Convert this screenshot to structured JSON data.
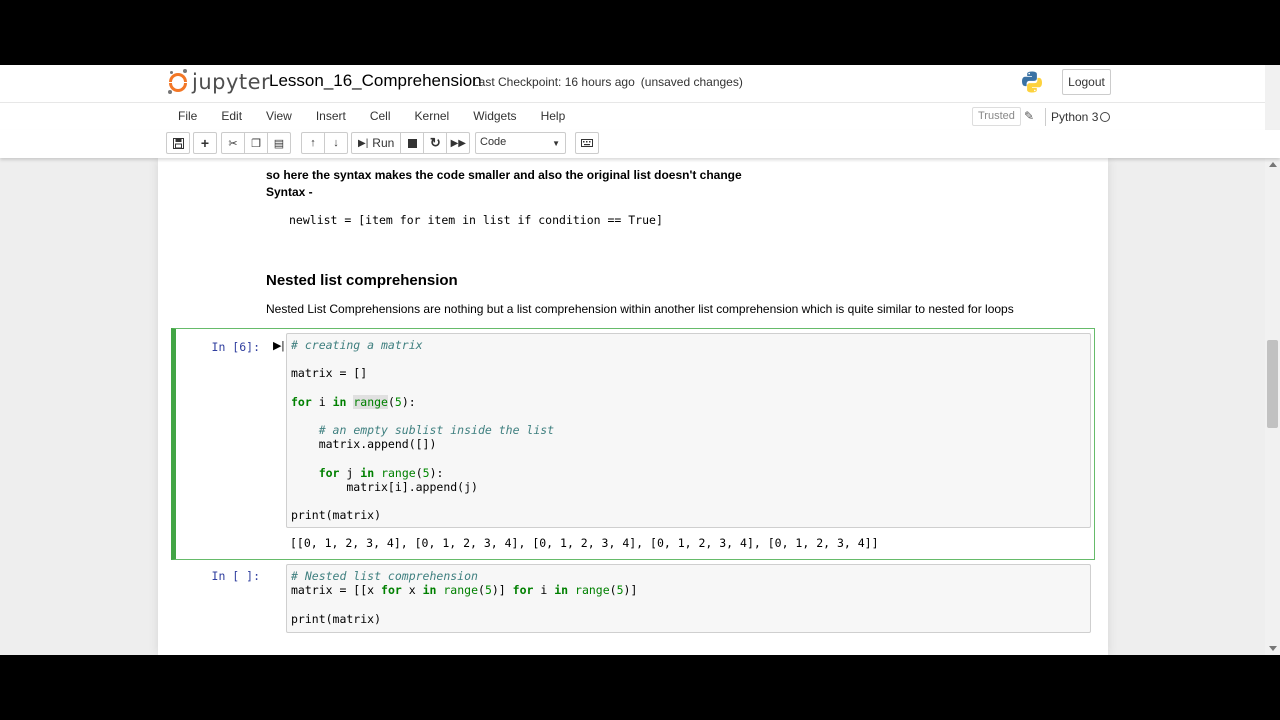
{
  "header": {
    "logo_text": "jupyter",
    "notebook_title": "Lesson_16_Comprehension",
    "checkpoint": "Last Checkpoint: 16 hours ago",
    "unsaved": "(unsaved changes)",
    "logout_label": "Logout"
  },
  "menubar": {
    "items": [
      "File",
      "Edit",
      "View",
      "Insert",
      "Cell",
      "Kernel",
      "Widgets",
      "Help"
    ],
    "trusted": "Trusted",
    "kernel_name": "Python 3"
  },
  "toolbar": {
    "run_label": "Run",
    "cell_type": "Code"
  },
  "markdown": {
    "line1": "so here the syntax makes the code smaller and also the original list doesn't change",
    "line2": "Syntax -",
    "code": "newlist = [item for item in list if condition == True]",
    "heading": "Nested list comprehension",
    "paragraph": "Nested List Comprehensions are nothing but a list comprehension within another list comprehension which is quite similar to nested for loops"
  },
  "cells": [
    {
      "prompt": "In [6]:",
      "output": "[[0, 1, 2, 3, 4], [0, 1, 2, 3, 4], [0, 1, 2, 3, 4], [0, 1, 2, 3, 4], [0, 1, 2, 3, 4]]"
    },
    {
      "prompt": "In [ ]:"
    }
  ],
  "colors": {
    "accent_orange": "#f37726",
    "selected_cell_green": "#42a545",
    "prompt_blue": "#303f9f"
  }
}
